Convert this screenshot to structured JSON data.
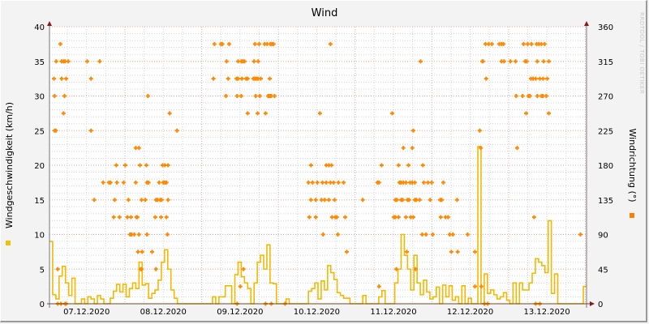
{
  "chart_data": {
    "type": "line",
    "title": "Wind",
    "ylabel": "Windgeschwindigkeit (km/h)",
    "ylabel_right": "Windrichtung (°)",
    "watermark": "RRDTOOL / TOBI OETIKER",
    "x_unit": "hours since 07.12.2020 00:00",
    "xlim": [
      0.4,
      168.4
    ],
    "ylim": [
      0,
      40
    ],
    "ylim_right": [
      0,
      360
    ],
    "y_ticks": [
      0,
      5,
      10,
      15,
      20,
      25,
      30,
      35,
      40
    ],
    "y_ticks_right": [
      0,
      45,
      90,
      135,
      180,
      225,
      270,
      315,
      360
    ],
    "x_tick_labels": [
      {
        "hour": 12,
        "label": "07.12.2020"
      },
      {
        "hour": 36,
        "label": "08.12.2020"
      },
      {
        "hour": 60,
        "label": "09.12.2020"
      },
      {
        "hour": 84,
        "label": "10.12.2020"
      },
      {
        "hour": 108,
        "label": "11.12.2020"
      },
      {
        "hour": 132,
        "label": "12.12.2020"
      },
      {
        "hour": 156,
        "label": "13.12.2020"
      }
    ],
    "grid": true,
    "series": [
      {
        "name": "Windgeschwindigkeit",
        "axis": "left",
        "style": "step",
        "color": "#f5b800",
        "start_hour": 0.4,
        "step_hours": 1,
        "values": [
          9,
          1.3,
          0.7,
          4.0,
          5.4,
          3.0,
          1.2,
          3.7,
          0,
          0,
          0.7,
          0,
          1.0,
          0.7,
          0,
          1.2,
          0.7,
          0,
          0,
          0.8,
          1.8,
          2.8,
          1.7,
          2.8,
          1.0,
          2.2,
          3.0,
          2.2,
          6.0,
          2.7,
          2.9,
          0.8,
          1.5,
          2.0,
          3.4,
          6.0,
          7.8,
          5.0,
          2.0,
          0.8,
          0,
          0,
          0,
          0,
          0,
          0,
          0,
          0,
          0,
          0,
          0,
          1.0,
          0,
          1.0,
          1.0,
          2.6,
          2.6,
          0,
          4.2,
          6.0,
          3.9,
          3.0,
          2.2,
          0,
          3.0,
          6.0,
          7.0,
          5.0,
          8.5,
          3.0,
          2.9,
          0,
          0,
          0,
          0.7,
          0,
          0,
          0,
          0,
          0,
          0,
          1.8,
          2.2,
          3.0,
          0.7,
          3.3,
          2.0,
          5.5,
          4.5,
          3.5,
          1.6,
          1.2,
          0.8,
          0.8,
          0,
          0,
          0,
          0,
          1.2,
          0,
          0,
          0,
          0,
          1.0,
          1.9,
          0,
          0,
          0,
          3.0,
          5.0,
          10.0,
          7.0,
          5.0,
          2.0,
          7.0,
          3.0,
          1.3,
          3.4,
          1.7,
          0.7,
          1.0,
          2.4,
          0,
          2.7,
          1.0,
          2.6,
          0.5,
          1.0,
          0,
          2.6,
          0,
          0.8,
          0,
          0,
          22.7,
          0,
          4.3,
          1.5,
          2.0,
          1.3,
          0.7,
          1.0,
          1.6,
          0.5,
          0,
          3.0,
          0,
          3.0,
          2.0,
          2.0,
          3.0,
          4.4,
          6.5,
          6.0,
          5.5,
          4.5,
          12.0,
          1.5,
          4.3,
          0,
          0,
          0,
          0,
          0,
          0,
          0,
          0,
          2.5
        ]
      },
      {
        "name": "Windrichtung",
        "axis": "right",
        "style": "points",
        "color": "#ff8800",
        "points_by_degree": {
          "337.5": [
            3.8,
            52.0,
            54.0,
            54.5,
            56.6,
            64.7,
            66.0,
            67.7,
            68.5,
            69.5,
            70.0,
            70.5,
            88.3,
            136.8,
            137.8,
            138.8,
            141.1,
            141.8,
            142.4,
            148.7,
            150.0,
            151.2,
            152.8,
            153.5,
            154.3,
            155.3
          ],
          "315": [
            2.5,
            4.2,
            4.8,
            5.3,
            6.3,
            12.2,
            16.1,
            55.8,
            59.4,
            60.4,
            60.9,
            61.4,
            64.4,
            65.7,
            116.5,
            135.8,
            136.0,
            141.8,
            142.6,
            144.6,
            146.2,
            149.2,
            149.7,
            153.0,
            155.0,
            156.6
          ],
          "292.5": [
            1.8,
            4.2,
            5.6,
            13.4,
            51.7,
            56.3,
            58.9,
            59.4,
            60.6,
            61.9,
            62.4,
            64.2,
            64.7,
            65.2,
            65.7,
            66.5,
            69.3,
            137.0,
            151.0,
            151.7,
            152.5,
            153.8,
            154.8,
            156.1
          ],
          "270": [
            2.0,
            5.1,
            31.2,
            55.6,
            59.1,
            60.4,
            64.9,
            66.2,
            68.8,
            69.3,
            69.8,
            70.8,
            146.4,
            148.4,
            150.2,
            150.7,
            153.0,
            154.3,
            154.8,
            155.8
          ],
          "247.5": [
            4.8,
            38.0,
            62.4,
            65.5,
            68.0,
            85.0,
            107.6,
            149.5,
            156.6
          ],
          "225": [
            2.0,
            2.4,
            13.4,
            40.3,
            114.2,
            135.0
          ],
          "202.5": [
            27.4,
            28.4,
            111.1,
            113.9,
            135.3,
            146.7
          ],
          "180": [
            21.3,
            24.1,
            28.7,
            30.7,
            35.8,
            36.5,
            37.5,
            82.2,
            87.0,
            87.8,
            88.6,
            104.3,
            109.6,
            112.7,
            117.2
          ],
          "157.5": [
            17.2,
            19.0,
            19.5,
            21.5,
            23.6,
            27.4,
            30.9,
            31.4,
            34.7,
            36.0,
            36.5,
            37.0,
            81.4,
            82.7,
            84.2,
            85.8,
            87.0,
            88.3,
            89.3,
            90.8,
            92.4,
            103.0,
            103.5,
            109.9,
            110.4,
            111.1,
            111.9,
            113.2,
            113.9,
            114.7,
            117.5,
            118.8,
            120.0,
            123.6
          ],
          "135": [
            14.4,
            20.8,
            25.1,
            29.2,
            30.4,
            33.7,
            34.2,
            35.0,
            35.5,
            37.5,
            82.2,
            83.7,
            85.5,
            86.5,
            87.8,
            89.6,
            98.4,
            108.6,
            109.1,
            110.4,
            110.9,
            112.4,
            112.9,
            114.7,
            115.2,
            116.2,
            119.5,
            122.6,
            123.1,
            127.9
          ],
          "112.5": [
            20.5,
            22.3,
            24.8,
            25.9,
            27.6,
            27.9,
            33.5,
            35.3,
            37.0,
            81.7,
            83.7,
            88.8,
            89.8,
            90.3,
            92.9,
            108.1,
            108.6,
            109.6,
            111.9,
            113.4,
            114.2,
            122.8,
            124.3,
            125.1,
            152.0
          ],
          "90": [
            25.6,
            26.1,
            26.9,
            28.4,
            30.9,
            37.3,
            86.0,
            90.6,
            117.0,
            118.2,
            120.3,
            125.6,
            126.6,
            131.2,
            166.5
          ],
          "67.5": [
            28.1,
            29.4,
            32.5,
            93.4,
            112.2,
            126.1,
            128.1,
            133.5
          ],
          "45": [
            3.0,
            28.9,
            29.2,
            33.7,
            61.1,
            108.9,
            114.9
          ],
          "22.5": [
            60.1,
            103.5,
            133.5,
            135.5
          ],
          "0": [
            3.0,
            4.0,
            5.3,
            5.6,
            59.1,
            68.0,
            69.8,
            74.1,
            136.5,
            137.5,
            152.5,
            153.8
          ]
        }
      }
    ]
  }
}
